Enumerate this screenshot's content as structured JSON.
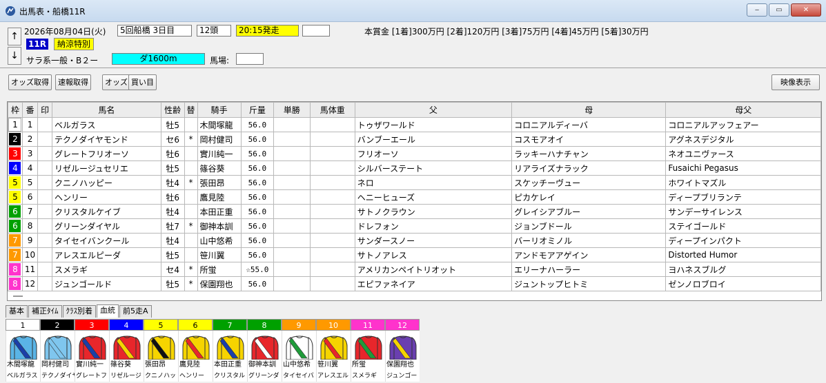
{
  "window": {
    "title": "出馬表・船橋11R",
    "minimize": "‒",
    "maximize": "▭",
    "close": "✕"
  },
  "header": {
    "date": "2026年08月04日(火)",
    "meeting": "5回船橋 3日目",
    "runners": "12頭",
    "start": "20:15発走",
    "blank1": "",
    "prize": "本賞金 [1着]300万円 [2着]120万円 [3着]75万円 [4着]45万円 [5着]30万円",
    "race_no": "11R",
    "race_name": "納涼特別",
    "class": "サラ系一般・B２ー",
    "course": "ダ1600m",
    "track_label": "馬場:",
    "track_value": "",
    "up": "↑",
    "down": "↓"
  },
  "toolbar": {
    "odds_get": "オッズ取得",
    "flash_get": "速報取得",
    "odds": "オッズ",
    "buy": "買い目",
    "video": "映像表示"
  },
  "table": {
    "headers": [
      "枠",
      "番",
      "印",
      "馬名",
      "性齢",
      "替",
      "騎手",
      "斤量",
      "単勝",
      "馬体重",
      "父",
      "母",
      "母父"
    ],
    "rows": [
      {
        "waku": "1",
        "ban": "1",
        "mark": "",
        "name": "ベルガラス",
        "sexage": "牡5",
        "kae": "",
        "jockey": "木間塚龍",
        "kin": "56.0",
        "odds": "",
        "weight": "",
        "sire": "トゥザワールド",
        "dam": "コロニアルディーバ",
        "damsire": "コロニアルアッフェアー"
      },
      {
        "waku": "2",
        "ban": "2",
        "mark": "",
        "name": "テクノダイヤモンド",
        "sexage": "セ6",
        "kae": "*",
        "jockey": "岡村健司",
        "kin": "56.0",
        "odds": "",
        "weight": "",
        "sire": "バンブーエール",
        "dam": "コスモアオイ",
        "damsire": "アグネスデジタル"
      },
      {
        "waku": "3",
        "ban": "3",
        "mark": "",
        "name": "グレートフリオーソ",
        "sexage": "牡6",
        "kae": "",
        "jockey": "實川純一",
        "kin": "56.0",
        "odds": "",
        "weight": "",
        "sire": "フリオーソ",
        "dam": "ラッキーハナチャン",
        "damsire": "ネオユニヴァース"
      },
      {
        "waku": "4",
        "ban": "4",
        "mark": "",
        "name": "リゼルージュセリエ",
        "sexage": "牡5",
        "kae": "",
        "jockey": "篠谷葵",
        "kin": "56.0",
        "odds": "",
        "weight": "",
        "sire": "シルバーステート",
        "dam": "リアライズナラック",
        "damsire": "Fusaichi Pegasus"
      },
      {
        "waku": "5",
        "ban": "5",
        "mark": "",
        "name": "クニノハッピー",
        "sexage": "牡4",
        "kae": "*",
        "jockey": "張田昂",
        "kin": "56.0",
        "odds": "",
        "weight": "",
        "sire": "ネロ",
        "dam": "スケッチーヴュー",
        "damsire": "ホワイトマズル"
      },
      {
        "waku": "5",
        "ban": "6",
        "mark": "",
        "name": "ヘンリー",
        "sexage": "牡6",
        "kae": "",
        "jockey": "鷹見陸",
        "kin": "56.0",
        "odds": "",
        "weight": "",
        "sire": "ヘニーヒューズ",
        "dam": "ピカケレイ",
        "damsire": "ディープブリランテ"
      },
      {
        "waku": "6",
        "ban": "7",
        "mark": "",
        "name": "クリスタルケイブ",
        "sexage": "牡4",
        "kae": "",
        "jockey": "本田正重",
        "kin": "56.0",
        "odds": "",
        "weight": "",
        "sire": "サトノクラウン",
        "dam": "グレイシアブルー",
        "damsire": "サンデーサイレンス"
      },
      {
        "waku": "6",
        "ban": "8",
        "mark": "",
        "name": "グリーンダイヤル",
        "sexage": "牡7",
        "kae": "*",
        "jockey": "御神本訓",
        "kin": "56.0",
        "odds": "",
        "weight": "",
        "sire": "ドレフォン",
        "dam": "ジョンブドール",
        "damsire": "ステイゴールド"
      },
      {
        "waku": "7",
        "ban": "9",
        "mark": "",
        "name": "タイセイバンクール",
        "sexage": "牡4",
        "kae": "",
        "jockey": "山中悠希",
        "kin": "56.0",
        "odds": "",
        "weight": "",
        "sire": "サンダースノー",
        "dam": "バーリオミノル",
        "damsire": "ディープインパクト"
      },
      {
        "waku": "7",
        "ban": "10",
        "mark": "",
        "name": "アレスエルピーダ",
        "sexage": "牡5",
        "kae": "",
        "jockey": "笹川翼",
        "kin": "56.0",
        "odds": "",
        "weight": "",
        "sire": "サトノアレス",
        "dam": "アンドモアアゲイン",
        "damsire": "Distorted Humor"
      },
      {
        "waku": "8",
        "ban": "11",
        "mark": "",
        "name": "スメラギ",
        "sexage": "セ4",
        "kae": "*",
        "jockey": "所蛍",
        "kin": "☆55.0",
        "odds": "",
        "weight": "",
        "sire": "アメリカンペイトリオット",
        "dam": "エリーナハーラー",
        "damsire": "ヨハネスブルグ"
      },
      {
        "waku": "8",
        "ban": "12",
        "mark": "",
        "name": "ジュンゴールド",
        "sexage": "牡5",
        "kae": "*",
        "jockey": "保園翔也",
        "kin": "56.0",
        "odds": "",
        "weight": "",
        "sire": "エピファネイア",
        "dam": "ジュントップヒトミ",
        "damsire": "ゼンノロブロイ"
      }
    ]
  },
  "waku_colors": {
    "1": {
      "bg": "#ffffff",
      "fg": "#000000"
    },
    "2": {
      "bg": "#000000",
      "fg": "#ffffff"
    },
    "3": {
      "bg": "#ff0000",
      "fg": "#ffffff"
    },
    "4": {
      "bg": "#0000ff",
      "fg": "#ffffff"
    },
    "5": {
      "bg": "#ffff00",
      "fg": "#000000"
    },
    "6": {
      "bg": "#00a000",
      "fg": "#ffffff"
    },
    "7": {
      "bg": "#ff9900",
      "fg": "#ffffff"
    },
    "8": {
      "bg": "#ff33cc",
      "fg": "#ffffff"
    }
  },
  "tabs": [
    "基本",
    "補正ﾀｲﾑ",
    "ｸﾗｽ別着",
    "血統",
    "前5走A"
  ],
  "active_tab": "血統",
  "silks": [
    {
      "no": "1",
      "waku": "1",
      "jockey": "木間塚龍",
      "horse": "ベルガラス",
      "body": "#5ab4e6",
      "sash": "#1a3fa8"
    },
    {
      "no": "2",
      "waku": "2",
      "jockey": "岡村健司",
      "horse": "テクノダイヤ",
      "body": "#7fc6ee",
      "sash": "#7fc6ee"
    },
    {
      "no": "3",
      "waku": "3",
      "jockey": "實川純一",
      "horse": "グレートフ",
      "body": "#e8262b",
      "sash": "#1a3fa8"
    },
    {
      "no": "4",
      "waku": "4",
      "jockey": "篠谷葵",
      "horse": "リゼルージ",
      "body": "#e8262b",
      "sash": "#f6d400"
    },
    {
      "no": "5",
      "waku": "5",
      "jockey": "張田昂",
      "horse": "クニノハッ",
      "body": "#f6d400",
      "sash": "#111111"
    },
    {
      "no": "6",
      "waku": "5",
      "jockey": "鷹見陸",
      "horse": "ヘンリー",
      "body": "#f6d400",
      "sash": "#e8262b"
    },
    {
      "no": "7",
      "waku": "6",
      "jockey": "本田正重",
      "horse": "クリスタル",
      "body": "#f6d400",
      "sash": "#1a3fa8"
    },
    {
      "no": "8",
      "waku": "6",
      "jockey": "御神本訓",
      "horse": "グリーンダ",
      "body": "#e8262b",
      "sash": "#ffffff"
    },
    {
      "no": "9",
      "waku": "7",
      "jockey": "山中悠希",
      "horse": "タイセイバ",
      "body": "#ffffff",
      "sash": "#1f9b3a"
    },
    {
      "no": "10",
      "waku": "7",
      "jockey": "笹川翼",
      "horse": "アレスエル",
      "body": "#f6d400",
      "sash": "#e8262b"
    },
    {
      "no": "11",
      "waku": "8",
      "jockey": "所蛍",
      "horse": "スメラギ",
      "body": "#e8262b",
      "sash": "#1f9b3a"
    },
    {
      "no": "12",
      "waku": "8",
      "jockey": "保園翔也",
      "horse": "ジュンゴー",
      "body": "#6a3fb0",
      "sash": "#f6d400"
    }
  ]
}
